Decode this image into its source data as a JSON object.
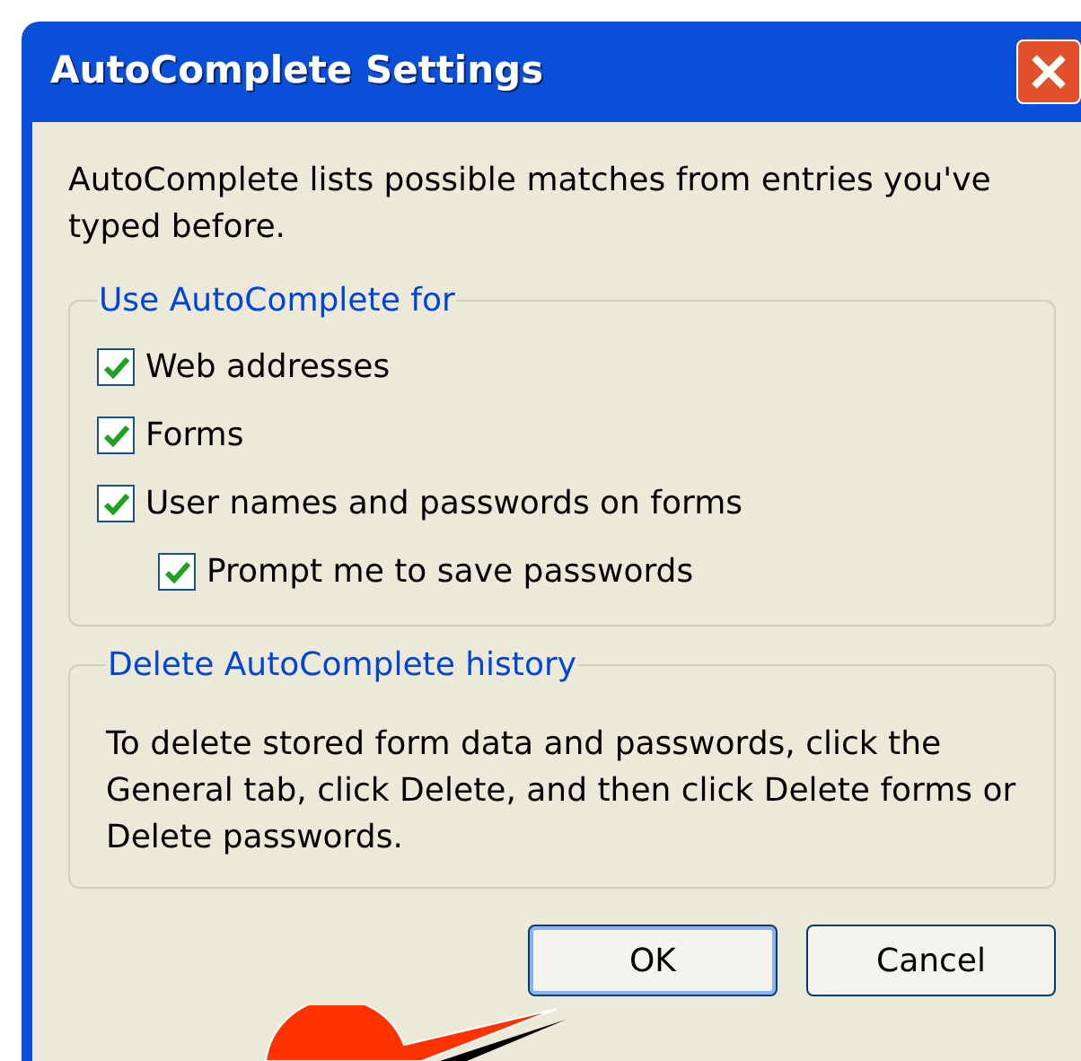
{
  "window": {
    "title": "AutoComplete Settings"
  },
  "intro": "AutoComplete lists possible matches from entries you've typed before.",
  "use_group": {
    "legend": "Use AutoComplete for",
    "options": [
      {
        "label": "Web addresses",
        "checked": true
      },
      {
        "label": "Forms",
        "checked": true
      },
      {
        "label": "User names and passwords on forms",
        "checked": true,
        "children": [
          {
            "label": "Prompt me to save passwords",
            "checked": true
          }
        ]
      }
    ]
  },
  "delete_group": {
    "legend": "Delete AutoComplete history",
    "text": "To delete stored form data and passwords, click the General tab, click Delete, and then click Delete forms or Delete passwords."
  },
  "buttons": [
    {
      "label": "OK",
      "default": true
    },
    {
      "label": "Cancel",
      "default": false
    }
  ]
}
